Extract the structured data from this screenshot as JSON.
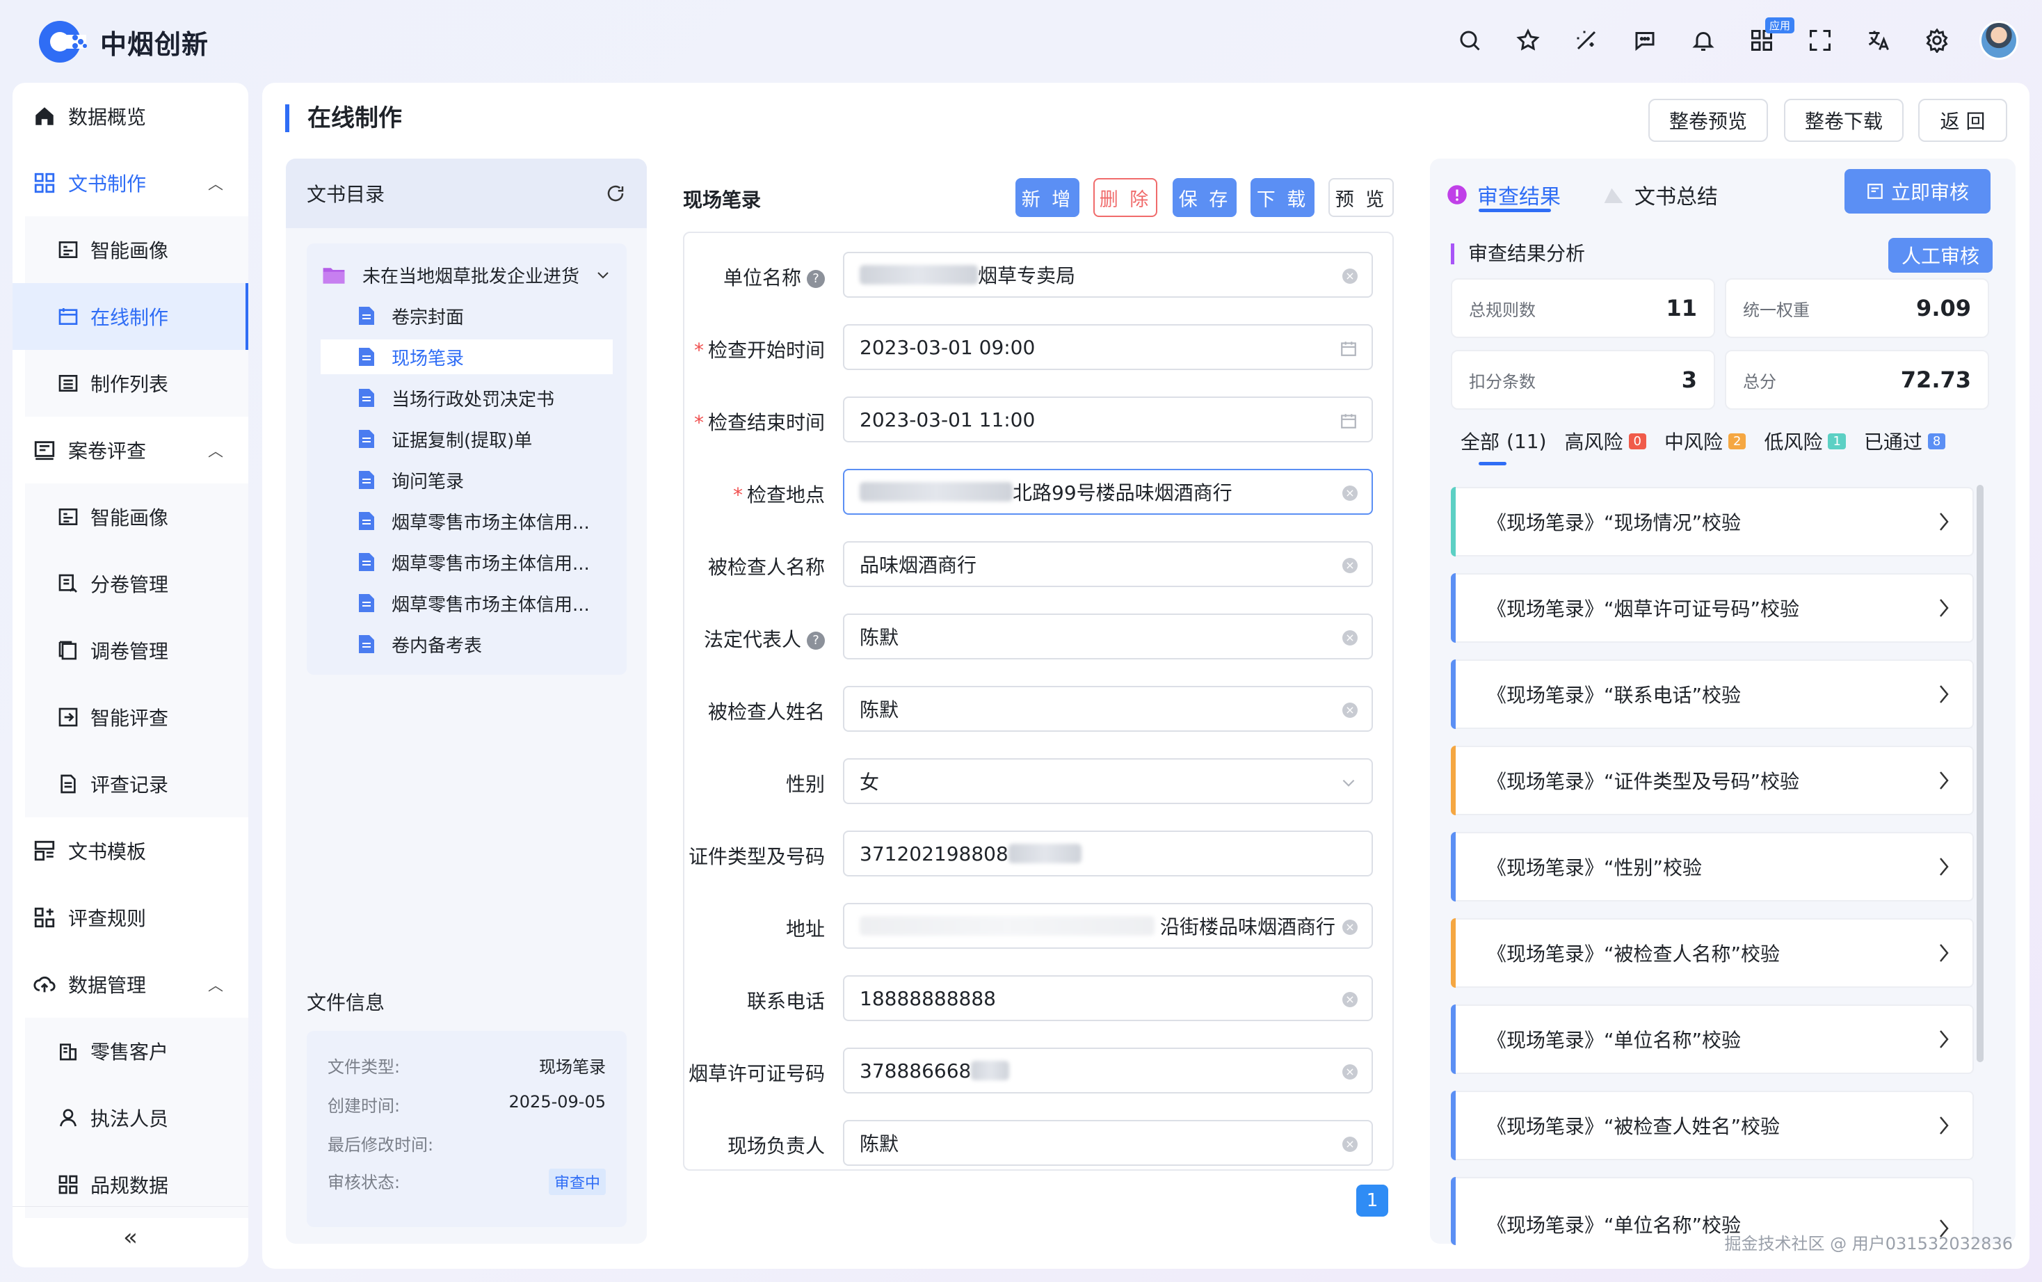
{
  "header": {
    "logo_text": "中烟创新",
    "icons": [
      "search-icon",
      "star-icon",
      "magic-icon",
      "chat-icon",
      "bell-icon",
      "apps-icon",
      "fullscreen-icon",
      "translate-icon",
      "settings-icon"
    ],
    "app_badge": "应用"
  },
  "sidebar": {
    "items": [
      {
        "label": "数据概览",
        "icon": "home-icon"
      },
      {
        "label": "文书制作",
        "icon": "grid-icon",
        "expanded": true
      },
      {
        "label": "智能画像",
        "icon": "profile-icon"
      },
      {
        "label": "在线制作",
        "icon": "edit-icon",
        "active": true
      },
      {
        "label": "制作列表",
        "icon": "list-icon"
      },
      {
        "label": "案卷评查",
        "icon": "case-icon",
        "expanded": true
      },
      {
        "label": "智能画像",
        "icon": "profile-icon"
      },
      {
        "label": "分卷管理",
        "icon": "split-icon"
      },
      {
        "label": "调卷管理",
        "icon": "copy-icon"
      },
      {
        "label": "智能评查",
        "icon": "review-icon"
      },
      {
        "label": "评查记录",
        "icon": "record-icon"
      },
      {
        "label": "文书模板",
        "icon": "template-icon"
      },
      {
        "label": "评查规则",
        "icon": "rules-icon"
      },
      {
        "label": "数据管理",
        "icon": "cloud-icon",
        "expanded": true
      },
      {
        "label": "零售客户",
        "icon": "store-icon"
      },
      {
        "label": "执法人员",
        "icon": "user-icon"
      },
      {
        "label": "品规数据",
        "icon": "data-icon"
      }
    ],
    "collapse": "«"
  },
  "page": {
    "title": "在线制作",
    "buttons": [
      "整卷预览",
      "整卷下载",
      "返 回"
    ]
  },
  "catalog": {
    "title": "文书目录",
    "folder": "未在当地烟草批发企业进货",
    "docs": [
      "卷宗封面",
      "现场笔录",
      "当场行政处罚决定书",
      "证据复制(提取)单",
      "询问笔录",
      "烟草零售市场主体信用...",
      "烟草零售市场主体信用...",
      "烟草零售市场主体信用...",
      "卷内备考表"
    ],
    "selected_index": 1
  },
  "file_info": {
    "title": "文件信息",
    "rows": [
      {
        "k": "文件类型:",
        "v": "现场笔录"
      },
      {
        "k": "创建时间:",
        "v": "2025-09-05"
      },
      {
        "k": "最后修改时间:",
        "v": ""
      },
      {
        "k": "审核状态:",
        "v": "审查中"
      }
    ]
  },
  "form": {
    "title": "现场笔录",
    "buttons": {
      "add": "新 增",
      "delete": "删 除",
      "save": "保 存",
      "download": "下 载",
      "preview": "预 览"
    },
    "fields": [
      {
        "label": "单位名称",
        "value": "烟草专卖局",
        "help": true,
        "required": false
      },
      {
        "label": "检查开始时间",
        "value": "2023-03-01 09:00",
        "required": true
      },
      {
        "label": "检查结束时间",
        "value": "2023-03-01 11:00",
        "required": true
      },
      {
        "label": "检查地点",
        "value": "北路99号楼品味烟酒商行",
        "required": true
      },
      {
        "label": "被检查人名称",
        "value": "品味烟酒商行"
      },
      {
        "label": "法定代表人",
        "value": "陈默",
        "help": true
      },
      {
        "label": "被检查人姓名",
        "value": "陈默"
      },
      {
        "label": "性别",
        "value": "女"
      },
      {
        "label": "证件类型及号码",
        "value": "371202198808"
      },
      {
        "label": "地址",
        "value": "沿街楼品味烟酒商行"
      },
      {
        "label": "联系电话",
        "value": "18888888888"
      },
      {
        "label": "烟草许可证号码",
        "value": "378886668"
      },
      {
        "label": "现场负责人",
        "value": "陈默"
      }
    ],
    "page": "1"
  },
  "review": {
    "tabs": [
      "审查结果",
      "文书总结"
    ],
    "audit_button": "立即审核",
    "analysis_title": "审查结果分析",
    "manual_button": "人工审核",
    "stats": [
      {
        "k": "总规则数",
        "v": "11"
      },
      {
        "k": "统一权重",
        "v": "9.09"
      },
      {
        "k": "扣分条数",
        "v": "3"
      },
      {
        "k": "总分",
        "v": "72.73"
      }
    ],
    "filters": [
      {
        "label": "全部",
        "count": "(11)"
      },
      {
        "label": "高风险",
        "count": "0"
      },
      {
        "label": "中风险",
        "count": "2"
      },
      {
        "label": "低风险",
        "count": "1"
      },
      {
        "label": "已通过",
        "count": "8"
      }
    ],
    "filter_colors": {
      "high": "#f05b4a",
      "mid": "#f5a742",
      "low": "#5cd0c4",
      "pass": "#5b8ff4"
    },
    "rules": [
      {
        "text": "《现场笔录》“现场情况”校验",
        "color": "#5cd0c4"
      },
      {
        "text": "《现场笔录》“烟草许可证号码”校验",
        "color": "#5b8ff4"
      },
      {
        "text": "《现场笔录》“联系电话”校验",
        "color": "#5b8ff4"
      },
      {
        "text": "《现场笔录》“证件类型及号码”校验",
        "color": "#f5a742"
      },
      {
        "text": "《现场笔录》“性别”校验",
        "color": "#5b8ff4"
      },
      {
        "text": "《现场笔录》“被检查人名称”校验",
        "color": "#f5a742"
      },
      {
        "text": "《现场笔录》“单位名称”校验",
        "color": "#5b8ff4"
      },
      {
        "text": "《现场笔录》“被检查人姓名”校验",
        "color": "#5b8ff4"
      },
      {
        "text": "《现场笔录》“单位名称”校验",
        "color": "#5b8ff4"
      }
    ]
  },
  "watermark": "掘金技术社区 @ 用户031532032836"
}
